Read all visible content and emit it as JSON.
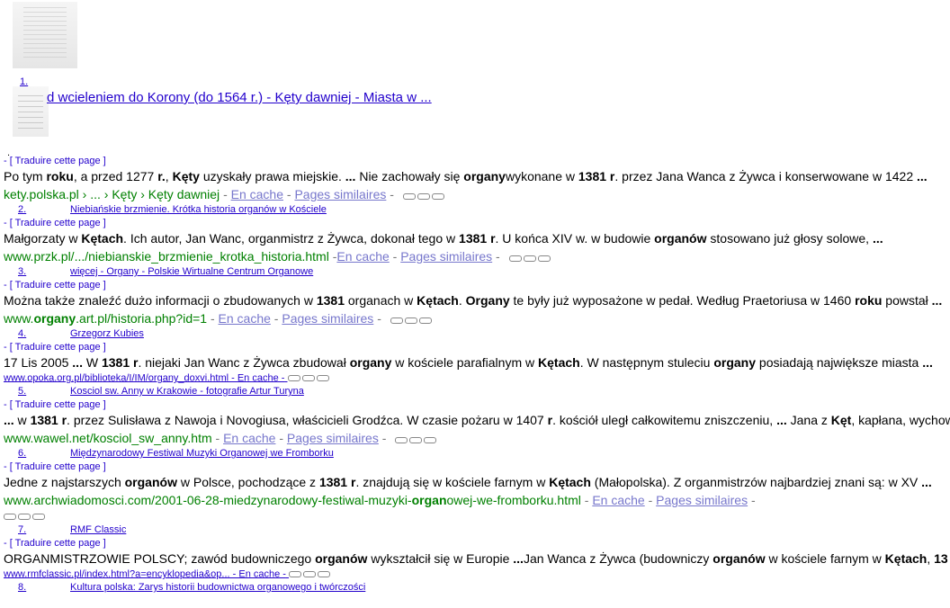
{
  "result1": {
    "number": "1.",
    "title": "d wcieleniem do Korony (do 1564 r.) - Kęty dawniej - Miasta w ...",
    "translate": "- [ Traduire cette page ]",
    "snippet_html": "Po tym <b>roku</b>, a przed 1277 <b>r.</b>, <b>Kęty</b> uzyskały prawa miejskie. <b>...</b> Nie zachowały się <b>organy</b>wykonane w <b>1381 r</b>. przez Jana Wanca z Żywca i konserwowane w 1422 <b>...</b>",
    "url": "kety.polska.pl › ... › Kęty › Kęty dawniej",
    "cache": "En cache",
    "similar": "Pages similaires"
  },
  "result2": {
    "number": "2.",
    "title": "Niebiańskie brzmienie. Krótka historia organów w Kościele",
    "translate": "- [ Traduire cette page ]",
    "snippet_html": "Małgorzaty w <b>Kętach</b>. Ich autor, Jan Wanc, organmistrz z Żywca, dokonał tego w <b>1381 r</b>. U końca XIV w. w budowie <b>organów</b> stosowano już głosy solowe, <b>...</b>",
    "url": "www.przk.pl/.../niebianskie_brzmienie_krotka_historia.html",
    "cache": "En cache",
    "similar": "Pages similaires"
  },
  "result3": {
    "number": "3.",
    "title": "więcej - Organy - Polskie Wirtualne Centrum Organowe",
    "translate": "- [ Traduire cette page ]",
    "snippet_html": "Można także znaleźć dużo informacji o zbudowanych w <b>1381</b> organach w <b>Kętach</b>. <b>Organy</b> te były już wyposażone w pedał. Według Praetoriusa w 1460 <b>roku</b> powstał <b>...</b>",
    "url_html": "www.<b>organy</b>.art.pl/historia.php?id=1",
    "cache": "En cache",
    "similar": "Pages similaires"
  },
  "result4": {
    "number": "4.",
    "title": "Grzegorz Kubies",
    "translate": "- [ Traduire cette page ]",
    "snippet_html": "17 Lis 2005 <b>...</b> W <b>1381 r</b>. niejaki Jan Wanc z Żywca zbudował <b>organy</b> w kościele parafialnym w <b>Kętach</b>. W następnym stuleciu <b>organy</b> posiadają największe miasta <b>...</b>",
    "url": "www.opoka.org.pl/biblioteka/I/IM/organy_doxvi.html - En cache -"
  },
  "result5": {
    "number": "5.",
    "title": "Kosciol sw. Anny w Krakowie - fotografie Artur Turyna",
    "translate": "- [ Traduire cette page ]",
    "snippet_html": "<b>...</b> w <b>1381 r</b>. przez Sulisława z Nawoja i Novogiusa, właścicieli Grodźca. W czasie pożaru w 1407 <b>r</b>. kościół uległ całkowitemu zniszczeniu, <b>...</b> Jana z <b>Kęt</b>, kapłana, wychow",
    "url": "www.wawel.net/kosciol_sw_anny.htm",
    "cache": "En cache",
    "similar": "Pages similaires"
  },
  "result6": {
    "number": "6.",
    "title": "Międzynarodowy Festiwal Muzyki Organowej we Fromborku",
    "translate": "- [ Traduire cette page ]",
    "snippet_html": "Jedne z najstarszych <b>organów</b> w Polsce, pochodzące z <b>1381 r</b>. znajdują się w kościele farnym w <b>Kętach</b> (Małopolska). Z organmistrzów najbardziej znani są: w XV <b>...</b>",
    "url_html": "www.archwiadomosci.com/2001-06-28-miedzynarodowy-festiwal-muzyki-<b>organ</b>owej-we-fromborku.html",
    "cache": "En cache",
    "similar": "Pages similaires"
  },
  "result7": {
    "number": "7.",
    "title": "RMF Classic",
    "translate": "- [ Traduire cette page ]",
    "snippet_html": "ORGANMISTRZOWIE POLSCY; zawód budowniczego <b>organów</b> wykształcił się w Europie <b>...</b>Jan Wanca z Żywca (budowniczy <b>organów</b> w kościele farnym w <b>Kętach</b>, <b>13</b>",
    "url": "www.rmfclassic.pl/index.html?a=encyklopedia&op... - En cache -"
  },
  "result8": {
    "number": "8.",
    "title": "Kultura polska: Zarys historii budownictwa organowego i twórczości"
  }
}
